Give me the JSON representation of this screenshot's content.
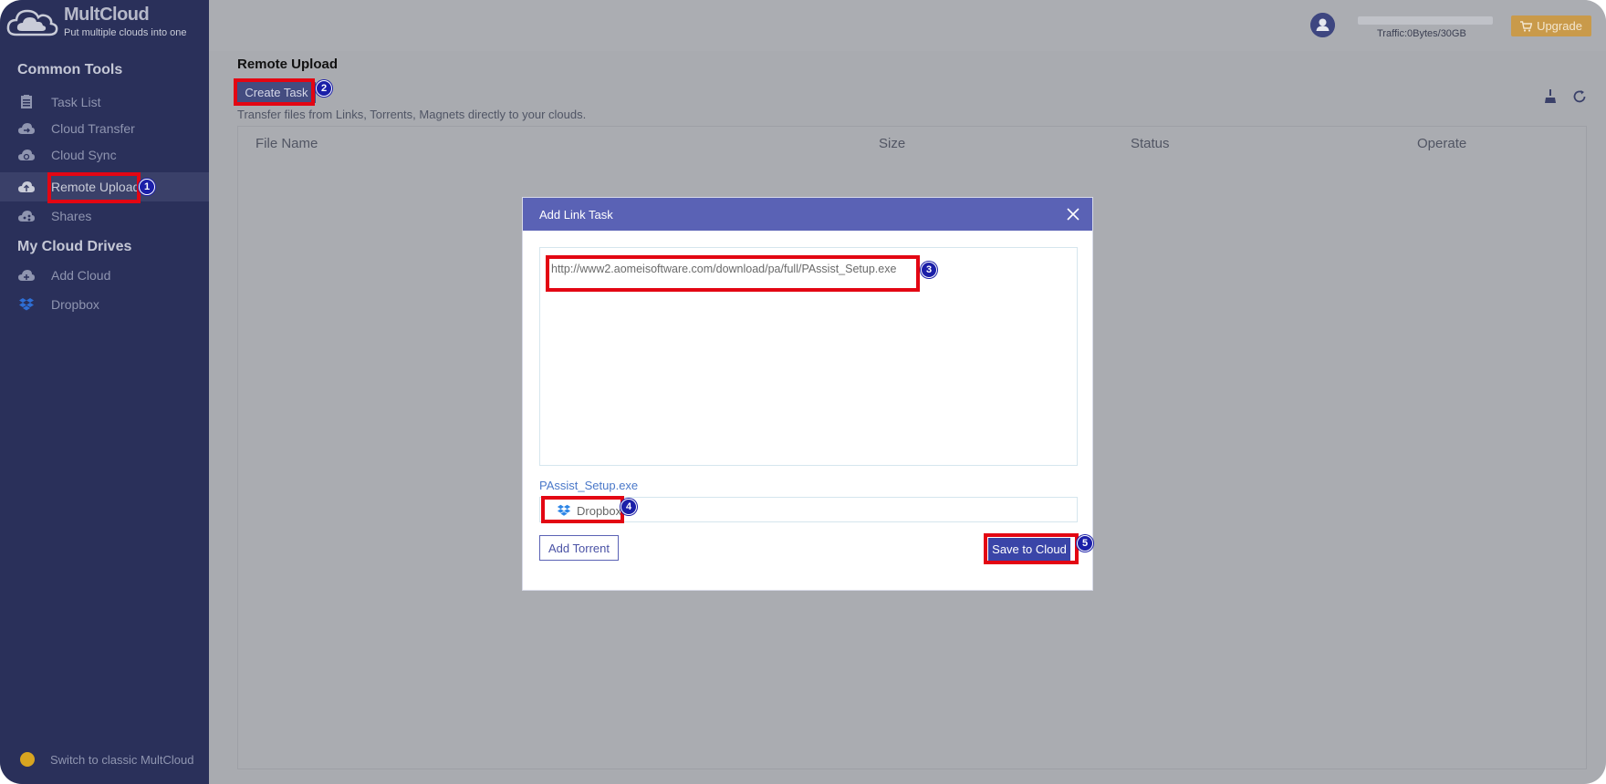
{
  "app": {
    "name": "MultCloud",
    "tagline": "Put multiple clouds into one"
  },
  "sidebar": {
    "common_tools_title": "Common Tools",
    "common_tools": [
      {
        "label": "Task List",
        "icon": "clipboard-icon"
      },
      {
        "label": "Cloud Transfer",
        "icon": "cloud-transfer-icon"
      },
      {
        "label": "Cloud Sync",
        "icon": "cloud-sync-icon"
      },
      {
        "label": "Remote Upload",
        "icon": "cloud-upload-icon",
        "active": true
      },
      {
        "label": "Shares",
        "icon": "share-icon"
      }
    ],
    "drives_title": "My Cloud Drives",
    "drives": [
      {
        "label": "Add Cloud",
        "icon": "cloud-add-icon"
      },
      {
        "label": "Dropbox",
        "icon": "dropbox-icon"
      }
    ],
    "switch_label": "Switch to classic MultCloud"
  },
  "header": {
    "traffic": "Traffic:0Bytes/30GB",
    "upgrade_label": "Upgrade"
  },
  "main": {
    "title": "Remote Upload",
    "create_task_label": "Create Task",
    "subtitle": "Transfer files from Links, Torrents, Magnets directly to your clouds.",
    "columns": [
      "File Name",
      "Size",
      "Status",
      "Operate"
    ]
  },
  "modal": {
    "title": "Add Link Task",
    "link": "http://www2.aomeisoftware.com/download/pa/full/PAssist_Setup.exe",
    "file_name": "PAssist_Setup.exe",
    "destination": "Dropbox",
    "add_torrent_label": "Add Torrent",
    "save_label": "Save to Cloud"
  },
  "annotations": [
    "1",
    "2",
    "3",
    "4",
    "5"
  ],
  "colors": {
    "sidebar_bg": "#2a305a",
    "highlight": "#e30613",
    "modal_header": "#5a62b5",
    "primary_button": "#3a45a8",
    "upgrade": "#c99a4a"
  }
}
